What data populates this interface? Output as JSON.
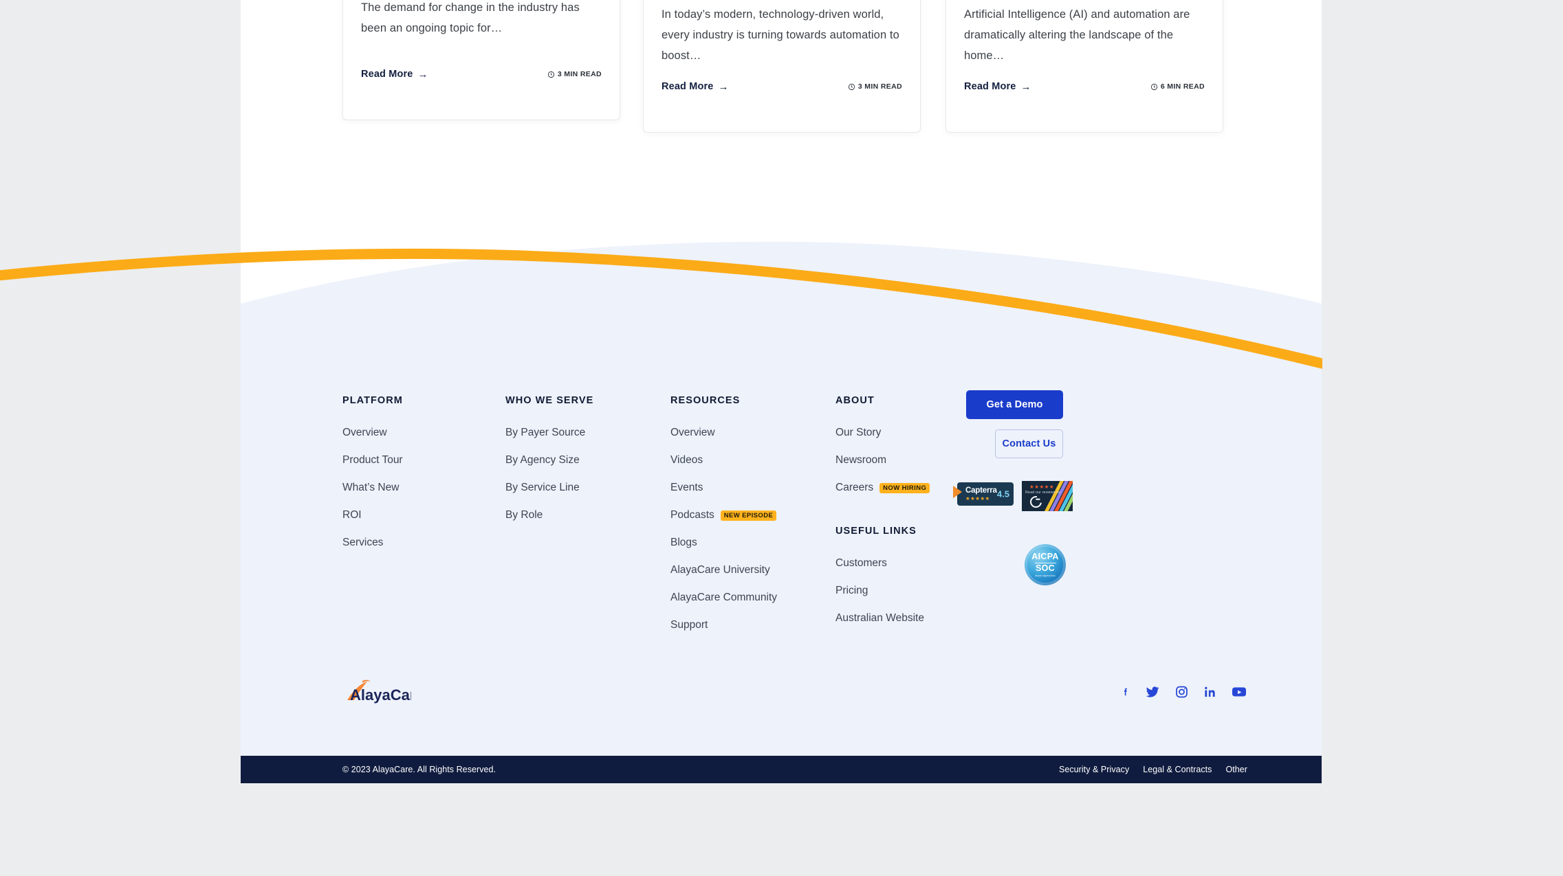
{
  "blog_cards": [
    {
      "excerpt": "The demand for change in the industry has been an ongoing topic for…",
      "read_more": "Read More",
      "arrow": "→",
      "read_time": "3 MIN READ",
      "clock_icon": "clock-icon"
    },
    {
      "excerpt": "In today’s modern, technology-driven world, every industry is turning towards automation to boost…",
      "read_more": "Read More",
      "arrow": "→",
      "read_time": "3 MIN READ",
      "clock_icon": "clock-icon"
    },
    {
      "excerpt": "Artificial Intelligence (AI) and automation are dramatically altering the landscape of the home…",
      "read_more": "Read More",
      "arrow": "→",
      "read_time": "6 MIN READ",
      "clock_icon": "clock-icon"
    }
  ],
  "footer": {
    "columns": {
      "platform": {
        "heading": "PLATFORM",
        "links": [
          "Overview",
          "Product Tour",
          "What’s New",
          "ROI",
          "Services"
        ]
      },
      "who_we_serve": {
        "heading": "WHO WE SERVE",
        "links": [
          "By Payer Source",
          "By Agency Size",
          "By Service Line",
          "By Role"
        ]
      },
      "resources": {
        "heading": "RESOURCES",
        "links": [
          "Overview",
          "Videos",
          "Events"
        ],
        "podcasts_label": "Podcasts",
        "podcasts_badge": "NEW EPISODE",
        "links_after": [
          "Blogs",
          "AlayaCare University",
          "AlayaCare Community",
          "Support"
        ]
      },
      "about": {
        "heading": "ABOUT",
        "links": [
          "Our Story",
          "Newsroom"
        ],
        "careers_label": "Careers",
        "careers_badge": "NOW HIRING"
      },
      "useful_links": {
        "heading": "USEFUL LINKS",
        "links": [
          "Customers",
          "Pricing",
          "Australian Website"
        ]
      }
    },
    "cta": {
      "demo_label": "Get a Demo",
      "contact_label": "Contact Us"
    },
    "badges": {
      "capterra": {
        "name": "Capterra",
        "score": "4.5",
        "stars": "★★★★★"
      },
      "g2": {
        "text": "Read our reviews on",
        "stars": "★★★★★",
        "logo": "g2-logo"
      },
      "aicpa": {
        "line1": "AICPA",
        "line2": "SOC",
        "sub": "aicpa.org/soc4so"
      }
    },
    "logo": {
      "text_a": "A",
      "text_rest": "layaCare",
      "swoosh_icon": "swoosh-icon"
    },
    "social": [
      {
        "name": "facebook-icon",
        "label": "Facebook"
      },
      {
        "name": "twitter-icon",
        "label": "Twitter"
      },
      {
        "name": "instagram-icon",
        "label": "Instagram"
      },
      {
        "name": "linkedin-icon",
        "label": "LinkedIn"
      },
      {
        "name": "youtube-icon",
        "label": "YouTube"
      }
    ],
    "bottom": {
      "copyright": "© 2023 AlayaCare. All Rights Reserved.",
      "links": [
        "Security & Privacy",
        "Legal & Contracts",
        "Other"
      ]
    }
  },
  "colors": {
    "accent_orange": "#FFB21D",
    "brand_blue": "#1A3CCB",
    "footer_bg": "#EEF2FB",
    "dark_navy": "#101C3F",
    "text_body": "#3D4452"
  }
}
